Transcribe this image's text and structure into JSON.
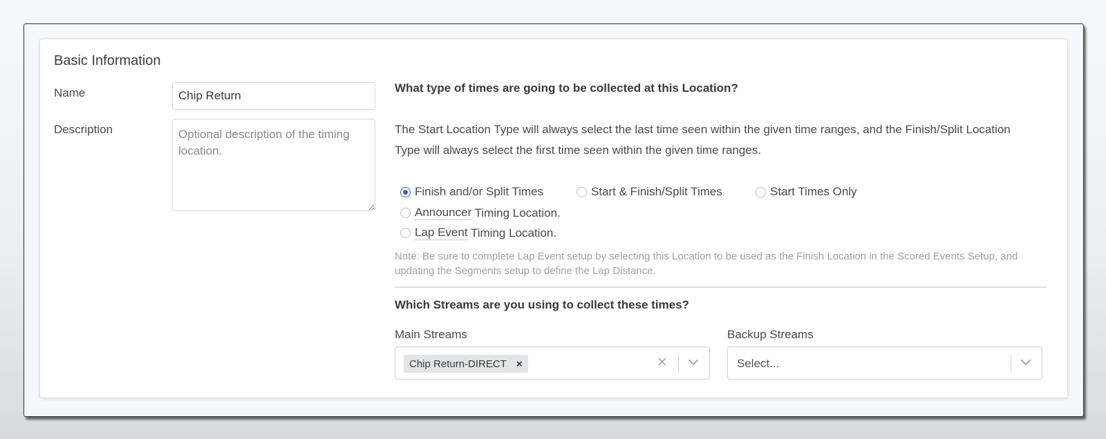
{
  "card": {
    "title": "Basic Information"
  },
  "form": {
    "name_label": "Name",
    "name_value": "Chip Return",
    "description_label": "Description",
    "description_placeholder": "Optional description of the timing location."
  },
  "times": {
    "question": "What type of times are going to be collected at this Location?",
    "info": "The Start Location Type will always select the last time seen within the given time ranges, and the Finish/Split Location Type will always select the first time seen within the given time ranges.",
    "options": [
      {
        "label": "Finish and/or Split Times",
        "checked": true
      },
      {
        "label": "Start & Finish/Split Times",
        "checked": false
      },
      {
        "label": "Start Times Only",
        "checked": false
      }
    ],
    "announcer": {
      "term": "Announcer",
      "rest": " Timing Location."
    },
    "lap_event": {
      "term": "Lap Event",
      "rest": " Timing Location."
    },
    "note": "Note: Be sure to complete Lap Event setup by selecting this Location to be used as the Finish Location in the Scored Events Setup, and updating the Segments setup to define the Lap Distance."
  },
  "streams": {
    "question": "Which Streams are you using to collect these times?",
    "main_label": "Main Streams",
    "main_selected": [
      "Chip Return-DIRECT"
    ],
    "backup_label": "Backup Streams",
    "backup_placeholder": "Select..."
  },
  "colors": {
    "accent": "#3f63ad",
    "note_text": "#9ea2a7",
    "frame_border": "#2f2f2f"
  },
  "icons": {
    "chip_remove": "×",
    "clear": "✕",
    "dropdown": "chevron-down"
  }
}
